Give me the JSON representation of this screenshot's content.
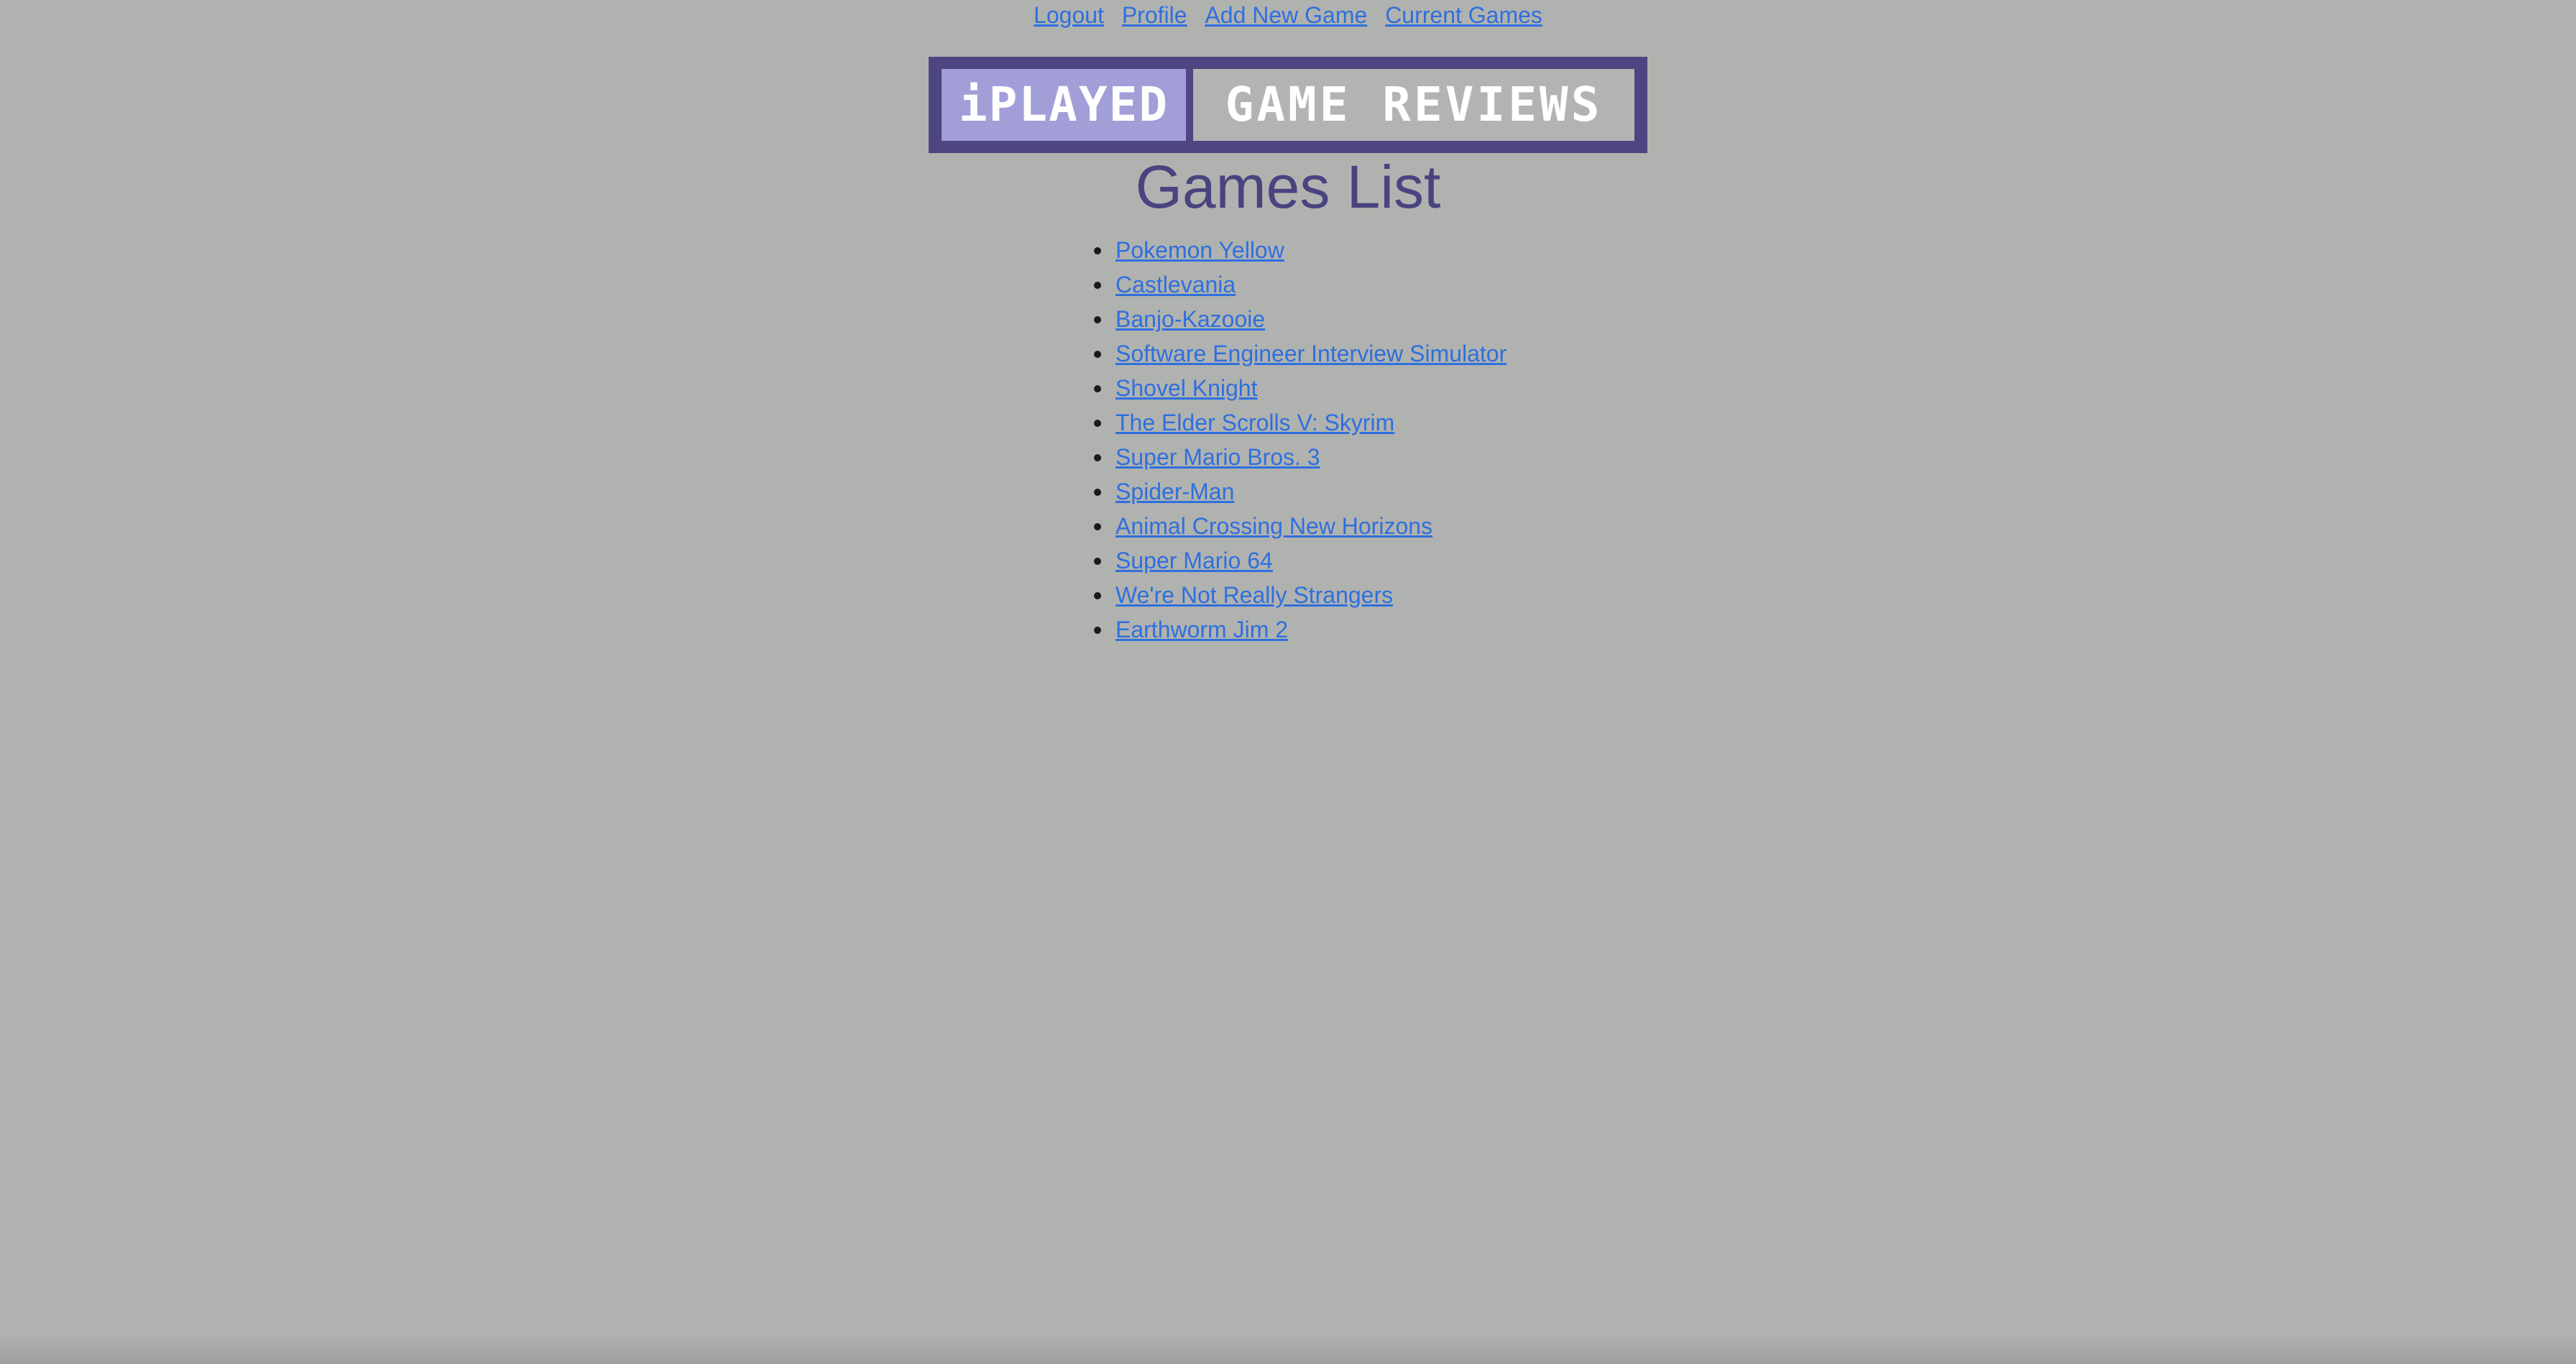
{
  "nav": {
    "links": [
      "Logout",
      "Profile",
      "Add New Game",
      "Current Games"
    ]
  },
  "logo": {
    "left_text": "iPLAYED",
    "right_text": "GAME REVIEWS"
  },
  "heading": "Games List",
  "games": [
    "Pokemon Yellow",
    "Castlevania",
    "Banjo-Kazooie",
    "Software Engineer Interview Simulator",
    "Shovel Knight",
    "The Elder Scrolls V: Skyrim",
    "Super Mario Bros. 3",
    "Spider-Man",
    "Animal Crossing New Horizons",
    "Super Mario 64",
    "We're Not Really Strangers",
    "Earthworm Jim 2"
  ],
  "colors": {
    "background": "#b0b2af",
    "link": "#2f6fde",
    "heading": "#4a4380",
    "logo_frame": "#4d4680",
    "logo_left_bg": "#a29ed8",
    "logo_right_bg": "#b3b3b6"
  }
}
